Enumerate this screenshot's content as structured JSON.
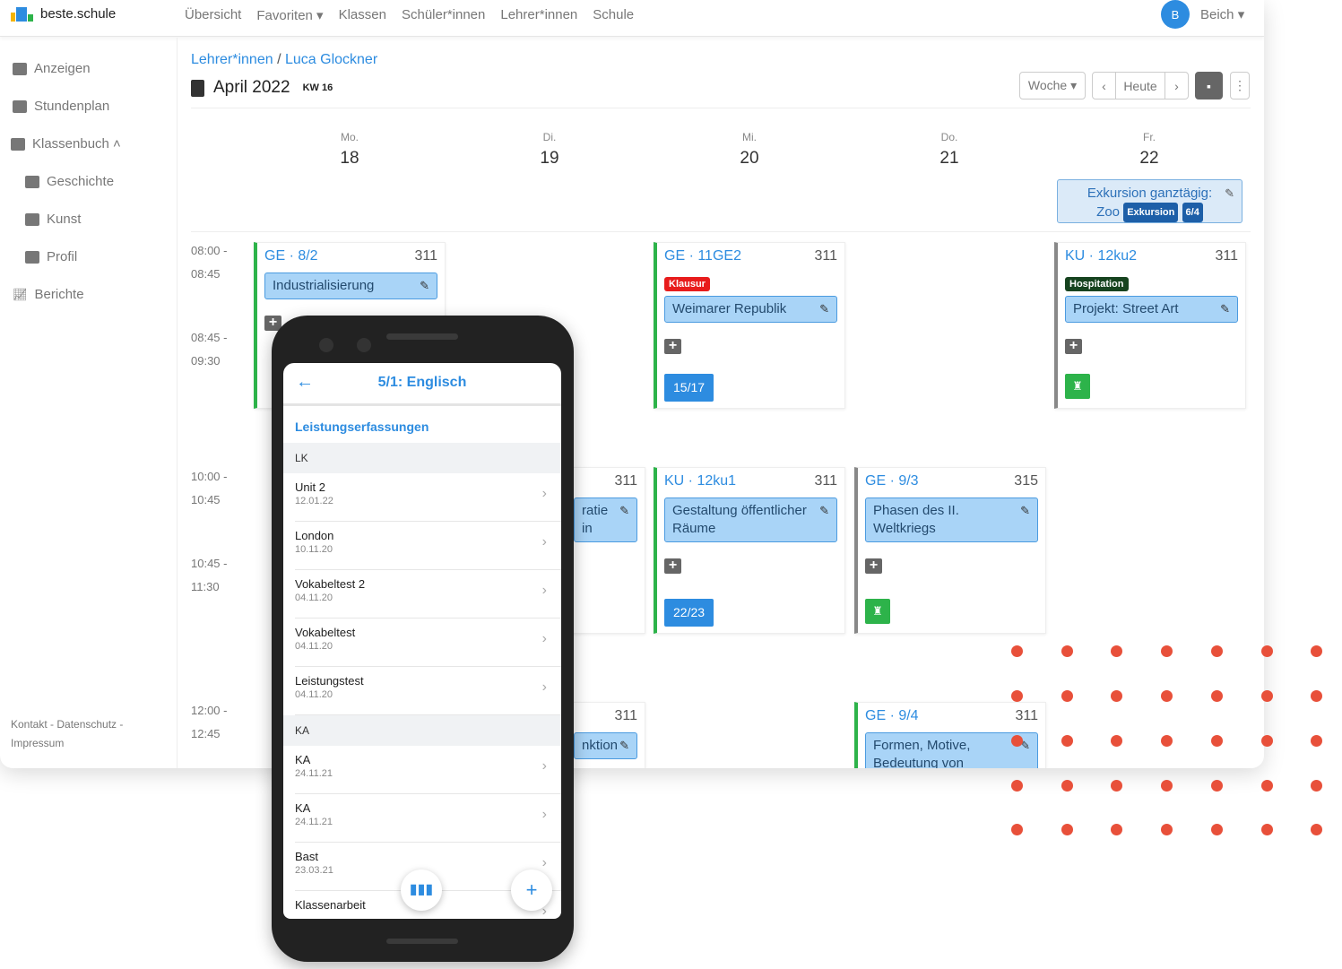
{
  "app": {
    "name": "beste.schule"
  },
  "nav": [
    "Übersicht",
    "Favoriten ▾",
    "Klassen",
    "Schüler*innen",
    "Lehrer*innen",
    "Schule"
  ],
  "user": {
    "initial": "B",
    "name": "Beich ▾"
  },
  "sidebar": {
    "items": [
      {
        "label": "Anzeigen"
      },
      {
        "label": "Stundenplan"
      },
      {
        "label": "Klassenbuch ˄"
      },
      {
        "label": "Geschichte"
      },
      {
        "label": "Kunst"
      },
      {
        "label": "Profil"
      },
      {
        "label": "Berichte"
      }
    ],
    "footer": "Kontakt - Datenschutz - Impressum"
  },
  "breadcrumb": {
    "parent": "Lehrer*innen",
    "sep": "/",
    "current": "Luca Glockner"
  },
  "header": {
    "title": "April 2022",
    "week": "KW 16"
  },
  "toolbar": {
    "view": "Woche ▾",
    "prev": "‹",
    "today": "Heute",
    "next": "›",
    "calendar": "▪",
    "more": "⋮"
  },
  "days": [
    {
      "name": "Mo.",
      "date": "18"
    },
    {
      "name": "Di.",
      "date": "19"
    },
    {
      "name": "Mi.",
      "date": "20"
    },
    {
      "name": "Do.",
      "date": "21"
    },
    {
      "name": "Fr.",
      "date": "22"
    }
  ],
  "allday": {
    "text1": "Exkursion ganztägig:",
    "text2": "Zoo",
    "badge1": "Exkursion",
    "badge2": "6/4"
  },
  "times": [
    [
      "08:00 -",
      "08:45"
    ],
    [
      "08:45 -",
      "09:30"
    ],
    [
      "10:00 -",
      "10:45"
    ],
    [
      "10:45 -",
      "11:30"
    ],
    [
      "12:00 -",
      "12:45"
    ]
  ],
  "events": [
    {
      "class": "GE · 8/2",
      "room": "311",
      "topic": "Industrialisierung",
      "border": "#2db34a"
    },
    {
      "class": "GE · 11GE2",
      "room": "311",
      "tag": "Klausur",
      "tag_color": "#e81c1c",
      "topic": "Weimarer Republik",
      "count": "15/17",
      "border": "#2db34a"
    },
    {
      "class": "KU · 12ku2",
      "room": "311",
      "tag": "Hospitation",
      "tag_color": "#16431f",
      "topic": "Projekt: Street Art",
      "green": "true",
      "border": "#888888"
    },
    {
      "class": "",
      "room": "311",
      "topic": "ratie in",
      "border": "#2db34a"
    },
    {
      "class": "KU · 12ku1",
      "room": "311",
      "topic": "Gestaltung öffentlicher Räume",
      "count": "22/23",
      "border": "#2db34a"
    },
    {
      "class": "GE · 9/3",
      "room": "315",
      "topic": "Phasen des II. Weltkriegs",
      "green": "true",
      "border": "#888888"
    },
    {
      "class": "",
      "room": "311",
      "topic": "nktion",
      "border": "#2db34a"
    },
    {
      "class": "GE · 9/4",
      "room": "311",
      "topic": "Formen, Motive, Bedeutung von",
      "border": "#2db34a"
    }
  ],
  "phone": {
    "title": "5/1: Englisch",
    "section": "Leistungserfassungen",
    "groups": [
      {
        "name": "LK",
        "items": [
          {
            "n": "Unit 2",
            "d": "12.01.22"
          },
          {
            "n": "London",
            "d": "10.11.20"
          },
          {
            "n": "Vokabeltest 2",
            "d": "04.11.20"
          },
          {
            "n": "Vokabeltest",
            "d": "04.11.20"
          },
          {
            "n": "Leistungstest",
            "d": "04.11.20"
          }
        ]
      },
      {
        "name": "KA",
        "items": [
          {
            "n": "KA",
            "d": "24.11.21"
          },
          {
            "n": "KA",
            "d": "24.11.21"
          },
          {
            "n": "Bast",
            "d": "23.03.21"
          },
          {
            "n": "Klassenarbeit",
            "d": ""
          }
        ]
      }
    ]
  },
  "colors": {
    "accent": "#2d8ce0",
    "dots": "#e8503a",
    "lesson_green": "#2db34a"
  }
}
